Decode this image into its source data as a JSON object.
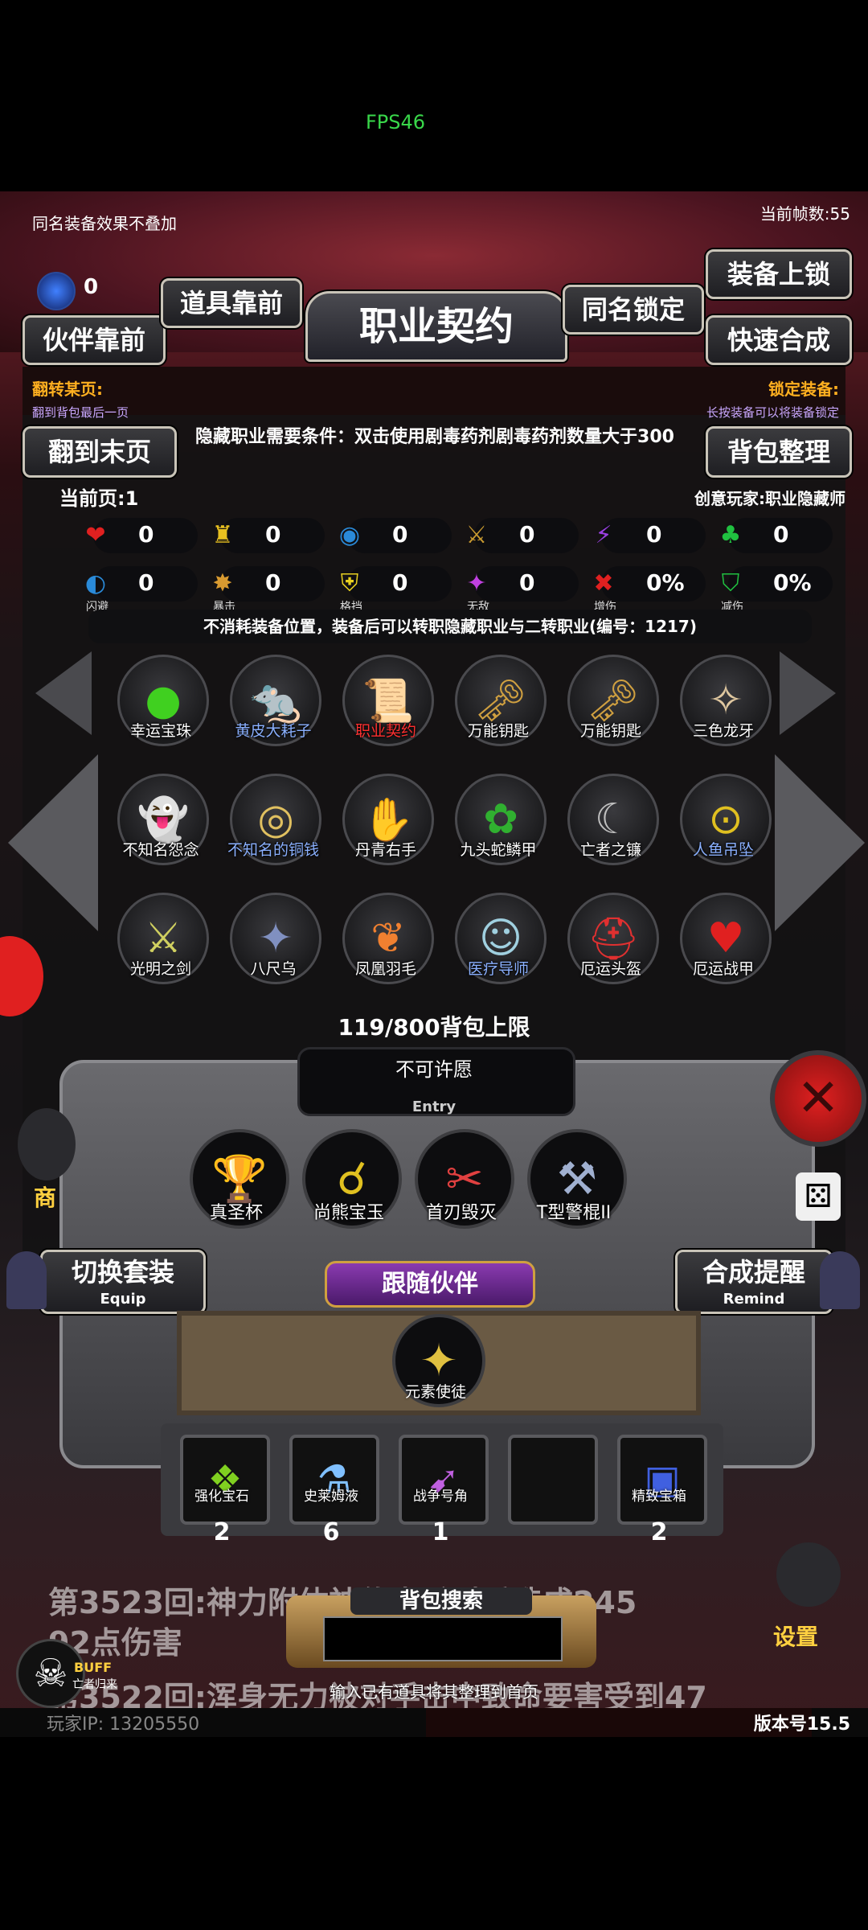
{
  "fps": "FPS46",
  "top": {
    "notice": "同名装备效果不叠加",
    "frame_count": "当前帧数:55",
    "gem_count": "0"
  },
  "buttons": {
    "partner_front": "伙伴靠前",
    "item_front": "道具靠前",
    "same_lock": "同名锁定",
    "equip_lock": "装备上锁",
    "quick_merge": "快速合成",
    "to_last_page": "翻到末页",
    "bag_sort": "背包整理",
    "switch_set": "切换套装",
    "switch_set_sub": "Equip",
    "merge_remind": "合成提醒",
    "merge_remind_sub": "Remind",
    "follow_partner": "跟随伙伴",
    "bag_search": "背包搜索",
    "settings": "设置",
    "shop_partial": "商"
  },
  "title": "职业契约",
  "flip_page": {
    "label": "翻转某页:",
    "desc": "翻到背包最后一页"
  },
  "lock_equip": {
    "label": "锁定装备:",
    "desc": "长按装备可以将装备锁定"
  },
  "description": {
    "condition": "隐藏职业需要条件：双击使用剧毒药剂剧毒药剂数量大于300",
    "current_page": "当前页:1",
    "creator": "创意玩家:职业隐藏师",
    "effect": "不消耗装备位置，装备后可以转职隐藏职业与二转职业(编号：1217)"
  },
  "stats_row1": [
    {
      "icon": "heart-icon",
      "glyph": "❤",
      "color": "#e02020",
      "value": "0"
    },
    {
      "icon": "armor-icon",
      "glyph": "♜",
      "color": "#e8c020",
      "value": "0"
    },
    {
      "icon": "boot-icon",
      "glyph": "◉",
      "color": "#2a8ad8",
      "value": "0"
    },
    {
      "icon": "sword-icon",
      "glyph": "⚔",
      "color": "#c89a30",
      "value": "0"
    },
    {
      "icon": "lightning-icon",
      "glyph": "⚡",
      "color": "#9a40e0",
      "value": "0"
    },
    {
      "icon": "clover-icon",
      "glyph": "♣",
      "color": "#20c040",
      "value": "0"
    }
  ],
  "stats_row2": [
    {
      "icon": "dodge-icon",
      "glyph": "◐",
      "color": "#2a8ad8",
      "value": "0",
      "caption": "闪避"
    },
    {
      "icon": "crit-icon",
      "glyph": "✸",
      "color": "#d89a30",
      "value": "0",
      "caption": "暴击"
    },
    {
      "icon": "block-icon",
      "glyph": "⛨",
      "color": "#e8d020",
      "value": "0",
      "caption": "格挡"
    },
    {
      "icon": "invincible-icon",
      "glyph": "✦",
      "color": "#c040e0",
      "value": "0",
      "caption": "无敌"
    },
    {
      "icon": "damage-up-icon",
      "glyph": "✖",
      "color": "#e02020",
      "value": "0%",
      "caption": "增伤"
    },
    {
      "icon": "damage-down-icon",
      "glyph": "⛉",
      "color": "#20c040",
      "value": "0%",
      "caption": "减伤"
    }
  ],
  "inventory": [
    {
      "name": "幸运宝珠",
      "glyph": "●",
      "color": "#40d020",
      "label_color": "#ffffff"
    },
    {
      "name": "黄皮大耗子",
      "glyph": "🐀",
      "color": "#c8c020",
      "label_color": "#8ab0ff"
    },
    {
      "name": "职业契约",
      "glyph": "📜",
      "color": "#e06030",
      "label_color": "#ff3030"
    },
    {
      "name": "万能钥匙",
      "glyph": "🗝",
      "color": "#d0a040",
      "label_color": "#ffffff"
    },
    {
      "name": "万能钥匙",
      "glyph": "🗝",
      "color": "#d0a040",
      "label_color": "#ffffff"
    },
    {
      "name": "三色龙牙",
      "glyph": "✧",
      "color": "#e0c8a0",
      "label_color": "#ffffff"
    },
    {
      "name": "不知名怨念",
      "glyph": "👻",
      "color": "#ffffff",
      "label_color": "#ffffff"
    },
    {
      "name": "不知名的铜钱",
      "glyph": "◎",
      "color": "#e0c060",
      "label_color": "#8ab0ff"
    },
    {
      "name": "丹青右手",
      "glyph": "✋",
      "color": "#d0d0d0",
      "label_color": "#ffffff"
    },
    {
      "name": "九头蛇鳞甲",
      "glyph": "✿",
      "color": "#30b030",
      "label_color": "#ffffff"
    },
    {
      "name": "亡者之镰",
      "glyph": "☾",
      "color": "#c0c0c0",
      "label_color": "#ffffff"
    },
    {
      "name": "人鱼吊坠",
      "glyph": "⊙",
      "color": "#e0c020",
      "label_color": "#8ab0ff"
    },
    {
      "name": "光明之剑",
      "glyph": "⚔",
      "color": "#d0d060",
      "label_color": "#ffffff"
    },
    {
      "name": "八尺乌",
      "glyph": "✦",
      "color": "#8090c0",
      "label_color": "#ffffff"
    },
    {
      "name": "凤凰羽毛",
      "glyph": "❦",
      "color": "#f08030",
      "label_color": "#ffffff"
    },
    {
      "name": "医疗导师",
      "glyph": "☺",
      "color": "#a0d0e0",
      "label_color": "#8ab0ff"
    },
    {
      "name": "厄运头盔",
      "glyph": "⛑",
      "color": "#e03030",
      "label_color": "#ffffff"
    },
    {
      "name": "厄运战甲",
      "glyph": "♥",
      "color": "#e02020",
      "label_color": "#ffffff"
    }
  ],
  "bag_capacity": "119/800背包上限",
  "entry": {
    "title": "不可许愿",
    "sub": "Entry"
  },
  "equipped": [
    {
      "name": "真圣杯",
      "glyph": "🏆",
      "color": "#e08030"
    },
    {
      "name": "尚熊宝玉",
      "glyph": "☌",
      "color": "#e0c020"
    },
    {
      "name": "首刃毁灭",
      "glyph": "✂",
      "color": "#e04040"
    },
    {
      "name": "T型警棍II",
      "glyph": "⚒",
      "color": "#a0b0d0"
    }
  ],
  "partner": {
    "name": "元素使徒",
    "glyph": "✦",
    "color": "#e0c040"
  },
  "consumables": [
    {
      "name": "强化宝石",
      "glyph": "❖",
      "color": "#80d020",
      "count": "2"
    },
    {
      "name": "史莱姆液",
      "glyph": "⚗",
      "color": "#80c0ff",
      "count": "6"
    },
    {
      "name": "战争号角",
      "glyph": "➹",
      "color": "#c060e0",
      "count": "1"
    },
    {
      "name": "",
      "glyph": "",
      "color": "#000000",
      "count": ""
    },
    {
      "name": "精致宝箱",
      "glyph": "▣",
      "color": "#4060e0",
      "count": "2"
    }
  ],
  "log": {
    "line1": "第3523回:神力附体神佑击杀对手造成245",
    "line1b": "92点伤害",
    "line2": "第3522回:浑身无力被对手击中致命要害受到47"
  },
  "search": {
    "hint": "输入已有道具将其整理到首页",
    "placeholder": ""
  },
  "buff": {
    "label": "BUFF",
    "sub": "亡者归来"
  },
  "footer": {
    "player_ip": "玩家IP:  13205550",
    "version": "版本号15.5"
  }
}
